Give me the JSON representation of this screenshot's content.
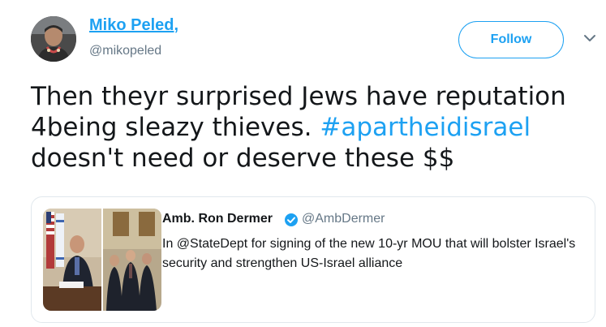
{
  "author": {
    "name": "Miko Peled,",
    "handle": "@mikopeled",
    "avatar_icon": "profile-photo"
  },
  "follow_button": {
    "label": "Follow"
  },
  "menu_icon": "chevron-down-icon",
  "tweet": {
    "line1": "Then theyr surprised Jews have reputation",
    "line2": "4being sleazy thieves. ",
    "hashtag": "#apartheidisrael",
    "line3": "doesn't need or deserve these $$"
  },
  "quoted_tweet": {
    "name": "Amb. Ron Dermer",
    "verified_icon": "verified-badge-icon",
    "handle": "@AmbDermer",
    "text": "In @StateDept for signing of the new 10-yr MOU that will bolster Israel's security and strengthen US-Israel alliance"
  },
  "colors": {
    "link_blue": "#1da1f2",
    "text_dark": "#14171a",
    "text_gray": "#657786",
    "card_border": "#e1e8ed"
  }
}
